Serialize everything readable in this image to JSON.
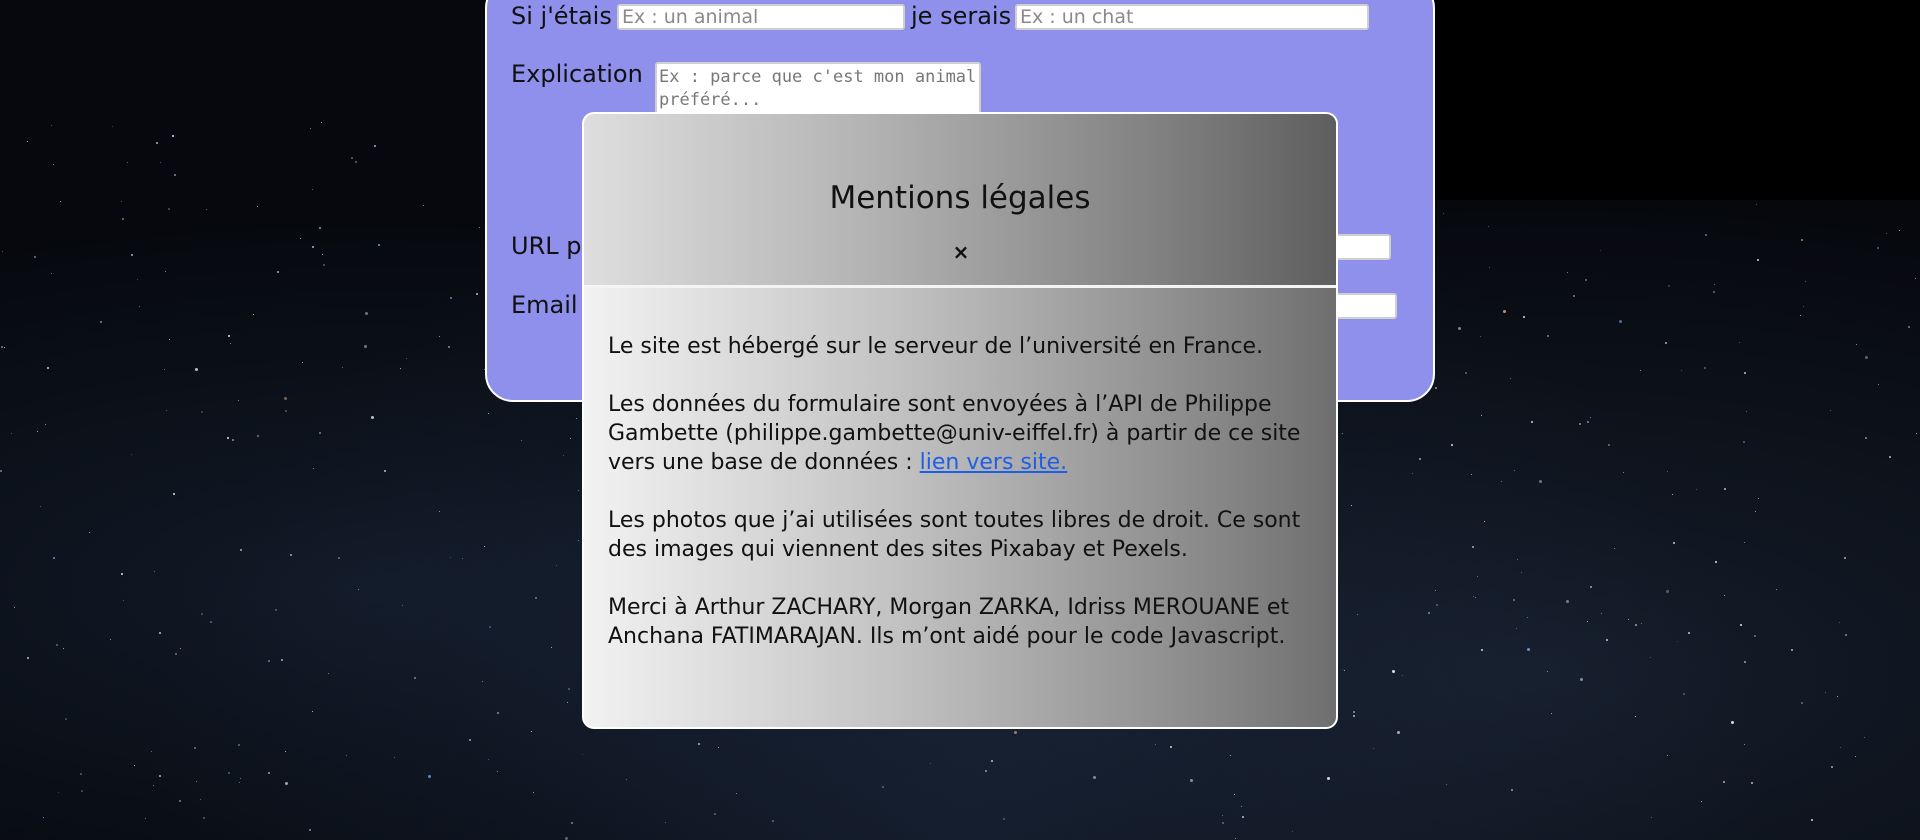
{
  "form": {
    "si_jetais_label": "Si j'étais",
    "si_jetais_placeholder": "Ex : un animal",
    "je_serais_label": "je serais",
    "je_serais_placeholder": "Ex : un chat",
    "explication_label": "Explication",
    "explication_placeholder": "Ex : parce que c'est mon animal préféré...",
    "url_label_visible": "URL p",
    "email_label_visible": "Email"
  },
  "modal": {
    "title": "Mentions légales",
    "close_symbol": "×",
    "paragraphs": {
      "hosting": "Le site est hébergé sur le serveur de l’université en France.",
      "api_text": "Les données du formulaire sont envoyées à l’API de Philippe Gambette (philippe.gambette@univ-eiffel.fr) à partir de ce site vers une base de données : ",
      "api_link": "lien vers site.",
      "photos": "Les photos que j’ai utilisées sont toutes libres de droit. Ce sont des images qui viennent des sites Pixabay et Pexels.",
      "thanks": "Merci à Arthur ZACHARY, Morgan ZARKA, Idriss MEROUANE et Anchana FATIMARAJAN. Ils m’ont aidé pour le code Javascript."
    }
  },
  "colors": {
    "form_background": "#8f8fec",
    "link": "#1f5fe6",
    "page_background": "#06080d"
  }
}
